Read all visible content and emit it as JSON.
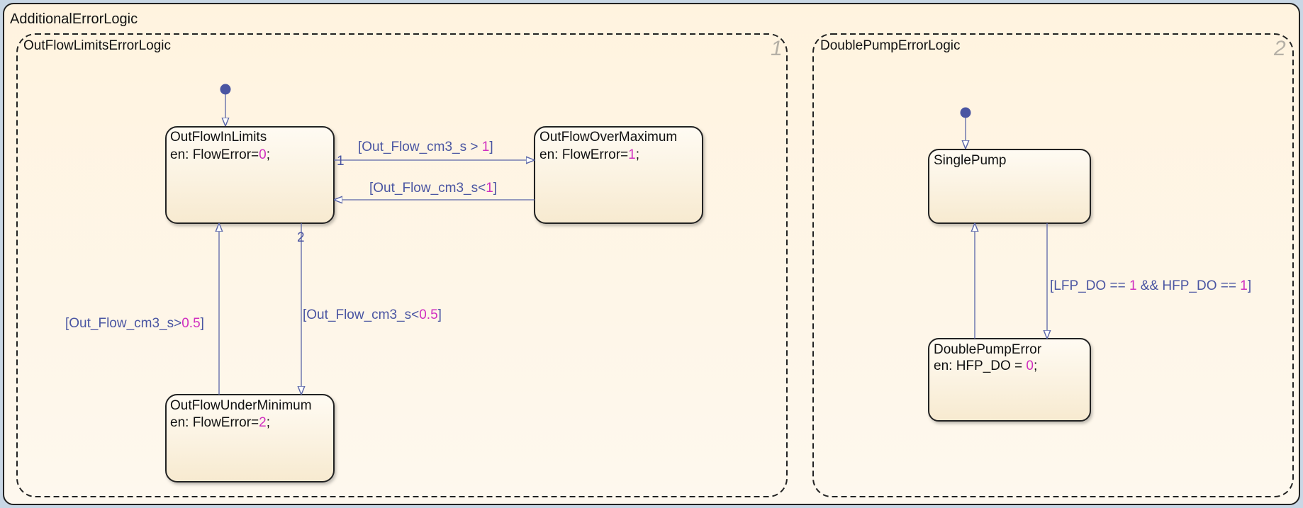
{
  "colors": {
    "state_fill_top": "#fffaf0",
    "state_fill_bottom": "#f6e9cf",
    "transition": "#5a65a8",
    "label": "#4a55a2",
    "number": "#d02fc0",
    "default_dot": "#4a55a2"
  },
  "chart": {
    "title": "AdditionalErrorLogic",
    "regions": [
      {
        "title": "OutFlowLimitsErrorLogic",
        "index": "1",
        "states": [
          {
            "name": "OutFlowInLimits",
            "action_prefix": "en: FlowError=",
            "action_value": "0",
            "action_suffix": ";"
          },
          {
            "name": "OutFlowOverMaximum",
            "action_prefix": "en: FlowError=",
            "action_value": "1",
            "action_suffix": ";"
          },
          {
            "name": "OutFlowUnderMinimum",
            "action_prefix": "en: FlowError=",
            "action_value": "2",
            "action_suffix": ";"
          }
        ],
        "transitions": [
          {
            "order": "1",
            "label_prefix": "[Out_Flow_cm3_s > ",
            "label_value": "1",
            "label_suffix": "]"
          },
          {
            "label_prefix": "[Out_Flow_cm3_s<",
            "label_value": "1",
            "label_suffix": "]"
          },
          {
            "order": "2",
            "label_prefix": "[Out_Flow_cm3_s<",
            "label_value": "0.5",
            "label_suffix": "]"
          },
          {
            "label_prefix": "[Out_Flow_cm3_s>",
            "label_value": "0.5",
            "label_suffix": "]"
          }
        ]
      },
      {
        "title": "DoublePumpErrorLogic",
        "index": "2",
        "states": [
          {
            "name": "SinglePump"
          },
          {
            "name": "DoublePumpError",
            "action_prefix": "en: HFP_DO = ",
            "action_value": "0",
            "action_suffix": ";"
          }
        ],
        "transitions": [
          {
            "label_a": "[LFP_DO == ",
            "value_a": "1",
            "label_b": " && HFP_DO == ",
            "value_b": "1",
            "label_c": "]"
          }
        ]
      }
    ]
  }
}
